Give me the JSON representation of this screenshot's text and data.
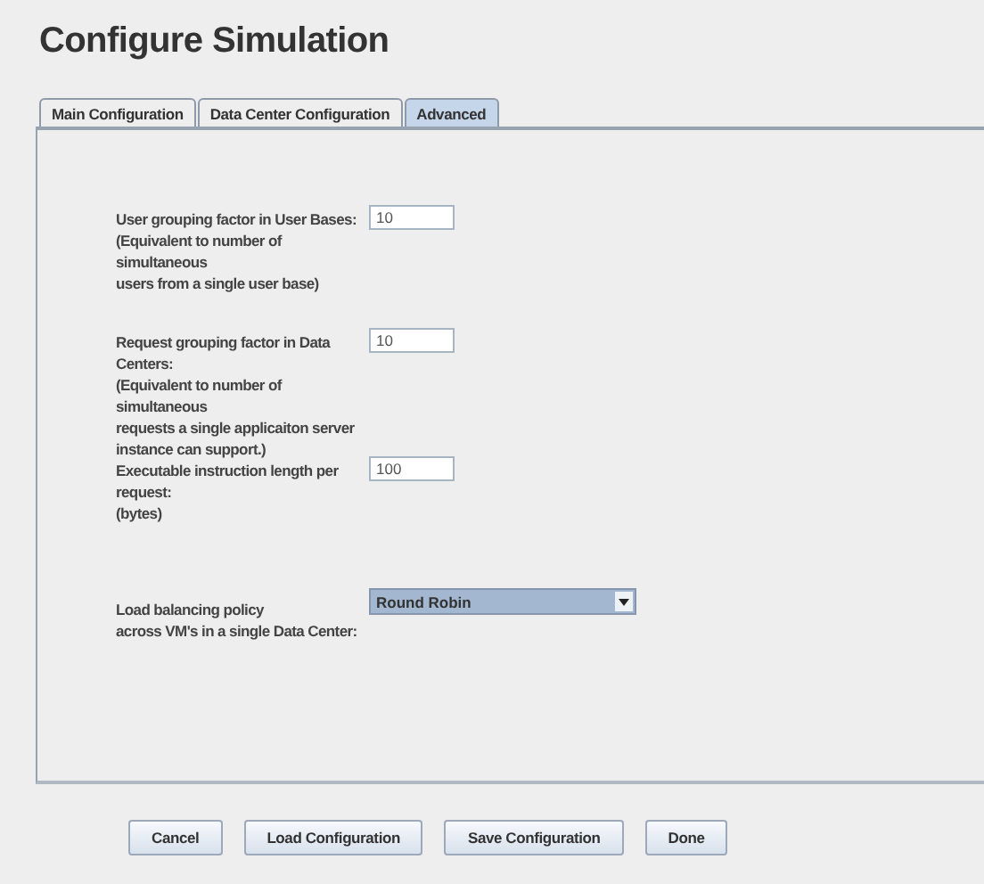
{
  "title": "Configure Simulation",
  "tabs": [
    {
      "label": "Main Configuration",
      "selected": false
    },
    {
      "label": "Data Center Configuration",
      "selected": false
    },
    {
      "label": "Advanced",
      "selected": true
    }
  ],
  "settings": [
    {
      "kind": "text",
      "label_lines": [
        "User grouping factor in User Bases:",
        "(Equivalent to number of simultaneous",
        "users from a single user base)"
      ],
      "value": "10"
    },
    {
      "kind": "text",
      "label_lines": [
        "Request grouping factor in Data Centers:",
        "(Equivalent to number of simultaneous",
        "requests a single applicaiton server",
        "instance can support.)"
      ],
      "value": "10"
    },
    {
      "kind": "text",
      "label_lines": [
        "Executable instruction length per request:",
        "(bytes)"
      ],
      "value": "100"
    },
    {
      "kind": "select",
      "label_lines": [
        "Load balancing policy",
        "across VM's in a single Data Center:"
      ],
      "value": "Round Robin"
    }
  ],
  "buttons": [
    "Cancel",
    "Load Configuration",
    "Save Configuration",
    "Done"
  ]
}
